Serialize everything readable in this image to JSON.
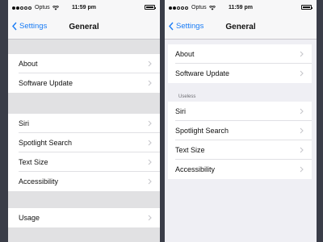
{
  "colors": {
    "background": "#3a3d48",
    "accent": "#1a7cf5",
    "grouped_background_left": "#e1e1e3",
    "grouped_background_right": "#efeff4"
  },
  "status_bar": {
    "carrier": "Optus",
    "time": "11:59 pm",
    "signal_bars_filled": 2,
    "signal_bars_total": 5
  },
  "left_screen": {
    "back_label": "Settings",
    "title": "General",
    "groups": [
      {
        "items": [
          {
            "label": "About"
          },
          {
            "label": "Software Update"
          }
        ]
      },
      {
        "items": [
          {
            "label": "Siri"
          },
          {
            "label": "Spotlight Search"
          },
          {
            "label": "Text Size"
          },
          {
            "label": "Accessibility"
          }
        ]
      },
      {
        "items": [
          {
            "label": "Usage"
          }
        ]
      }
    ]
  },
  "right_screen": {
    "back_label": "Settings",
    "title": "General",
    "groups": [
      {
        "header": "",
        "items": [
          {
            "label": "About"
          },
          {
            "label": "Software Update"
          }
        ]
      },
      {
        "header": "Useless",
        "items": [
          {
            "label": "Siri"
          },
          {
            "label": "Spotlight Search"
          },
          {
            "label": "Text Size"
          },
          {
            "label": "Accessibility"
          }
        ]
      }
    ]
  }
}
